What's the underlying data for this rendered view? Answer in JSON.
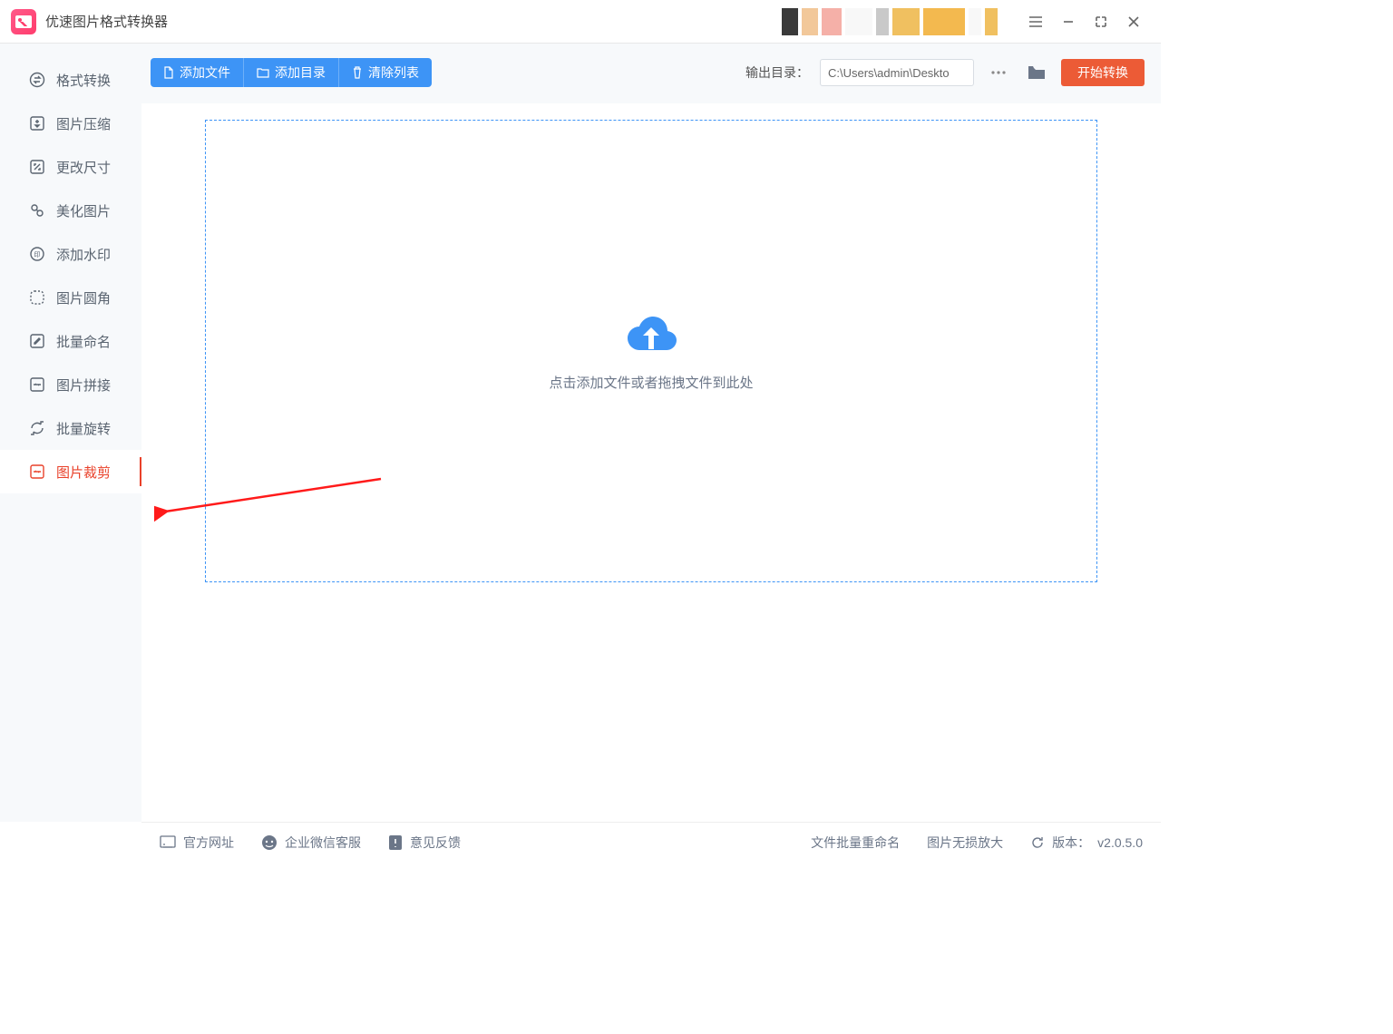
{
  "app": {
    "title": "优速图片格式转换器"
  },
  "sidebar": {
    "items": [
      {
        "label": "格式转换",
        "icon": "swap-icon"
      },
      {
        "label": "图片压缩",
        "icon": "compress-icon"
      },
      {
        "label": "更改尺寸",
        "icon": "resize-icon"
      },
      {
        "label": "美化图片",
        "icon": "beautify-icon"
      },
      {
        "label": "添加水印",
        "icon": "watermark-icon"
      },
      {
        "label": "图片圆角",
        "icon": "round-corner-icon"
      },
      {
        "label": "批量命名",
        "icon": "rename-icon"
      },
      {
        "label": "图片拼接",
        "icon": "stitch-icon"
      },
      {
        "label": "批量旋转",
        "icon": "rotate-icon"
      },
      {
        "label": "图片裁剪",
        "icon": "crop-icon"
      }
    ],
    "active_index": 9
  },
  "toolbar": {
    "add_file": "添加文件",
    "add_folder": "添加目录",
    "clear_list": "清除列表",
    "output_label": "输出目录：",
    "output_path": "C:\\Users\\admin\\Deskto",
    "start": "开始转换"
  },
  "dropzone": {
    "text": "点击添加文件或者拖拽文件到此处"
  },
  "footer": {
    "official_site": "官方网址",
    "wechat_support": "企业微信客服",
    "feedback": "意见反馈",
    "batch_rename": "文件批量重命名",
    "lossless_zoom": "图片无损放大",
    "version_label": "版本：",
    "version": "v2.0.5.0"
  },
  "colors": {
    "primary": "#3d94f6",
    "accent": "#ec5b36",
    "active": "#e9412a"
  }
}
